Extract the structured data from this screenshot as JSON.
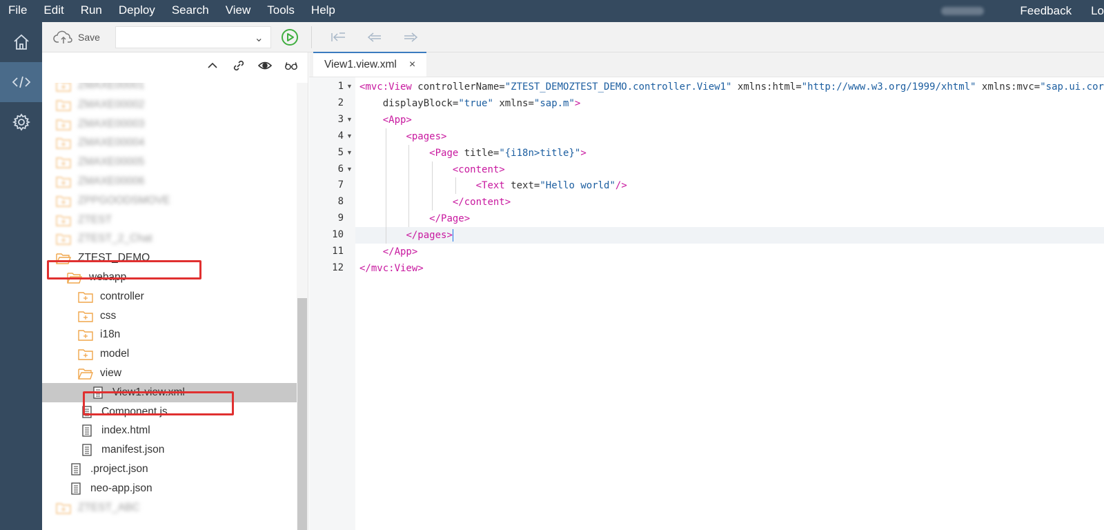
{
  "menubar": {
    "items": [
      "File",
      "Edit",
      "Run",
      "Deploy",
      "Search",
      "View",
      "Tools",
      "Help"
    ],
    "feedback": "Feedback",
    "logout": "Lo"
  },
  "toolbar": {
    "save_label": "Save",
    "combo_value": ""
  },
  "tree": {
    "items": [
      {
        "label": "ZMAXE00001",
        "kind": "folder-closed",
        "blurred": true
      },
      {
        "label": "ZMAXE00002",
        "kind": "folder-closed",
        "blurred": true
      },
      {
        "label": "ZMAXE00003",
        "kind": "folder-closed",
        "blurred": true
      },
      {
        "label": "ZMAXE00004",
        "kind": "folder-closed",
        "blurred": true
      },
      {
        "label": "ZMAXE00005",
        "kind": "folder-closed",
        "blurred": true
      },
      {
        "label": "ZMAXE00006",
        "kind": "folder-closed",
        "blurred": true
      },
      {
        "label": "ZPPGOODSMOVE",
        "kind": "folder-closed",
        "blurred": true
      },
      {
        "label": "ZTEST",
        "kind": "folder-closed",
        "blurred": true
      },
      {
        "label": "ZTEST_2_Chat",
        "kind": "folder-closed",
        "blurred": true
      },
      {
        "label": "ZTEST_DEMO",
        "kind": "folder-open",
        "blurred": false
      },
      {
        "label": "webapp",
        "kind": "folder-open",
        "blurred": false
      },
      {
        "label": "controller",
        "kind": "folder-closed",
        "blurred": false
      },
      {
        "label": "css",
        "kind": "folder-closed",
        "blurred": false
      },
      {
        "label": "i18n",
        "kind": "folder-closed",
        "blurred": false
      },
      {
        "label": "model",
        "kind": "folder-closed",
        "blurred": false
      },
      {
        "label": "view",
        "kind": "folder-open",
        "blurred": false
      },
      {
        "label": "View1.view.xml",
        "kind": "file",
        "blurred": false
      },
      {
        "label": "Component.js",
        "kind": "file",
        "blurred": false
      },
      {
        "label": "index.html",
        "kind": "file",
        "blurred": false
      },
      {
        "label": "manifest.json",
        "kind": "file",
        "blurred": false
      },
      {
        "label": ".project.json",
        "kind": "file",
        "blurred": false
      },
      {
        "label": "neo-app.json",
        "kind": "file",
        "blurred": false
      },
      {
        "label": "ZTEST_ABC",
        "kind": "folder-closed",
        "blurred": true
      }
    ],
    "selected_index": 16
  },
  "editor": {
    "tab_label": "View1.view.xml",
    "tab_close": "×",
    "active_line": 10,
    "lines": [
      [
        [
          "tag",
          "<mvc:View"
        ],
        [
          "attr",
          " controllerName"
        ],
        [
          "eq",
          "="
        ],
        [
          "val",
          "\"ZTEST_DEMOZTEST_DEMO.controller.View1\""
        ],
        [
          "attr",
          " xmlns:html"
        ],
        [
          "eq",
          "="
        ],
        [
          "val",
          "\"http://www.w3.org/1999/xhtml\""
        ],
        [
          "attr",
          " xmlns:mvc"
        ],
        [
          "eq",
          "="
        ],
        [
          "val",
          "\"sap.ui.core.mvc\""
        ]
      ],
      [
        [
          "attr",
          "displayBlock"
        ],
        [
          "eq",
          "="
        ],
        [
          "val",
          "\"true\""
        ],
        [
          "attr",
          " xmlns"
        ],
        [
          "eq",
          "="
        ],
        [
          "val",
          "\"sap.m\""
        ],
        [
          "tag",
          ">"
        ]
      ],
      [
        [
          "tag",
          "<App>"
        ]
      ],
      [
        [
          "tag",
          "<pages>"
        ]
      ],
      [
        [
          "tag",
          "<Page"
        ],
        [
          "attr",
          " title"
        ],
        [
          "eq",
          "="
        ],
        [
          "val",
          "\"{i18n>title}\""
        ],
        [
          "tag",
          ">"
        ]
      ],
      [
        [
          "tag",
          "<content>"
        ]
      ],
      [
        [
          "tag",
          "<Text"
        ],
        [
          "attr",
          " text"
        ],
        [
          "eq",
          "="
        ],
        [
          "val",
          "\"Hello world\""
        ],
        [
          "tag",
          "/>"
        ]
      ],
      [
        [
          "tag",
          "</content>"
        ]
      ],
      [
        [
          "tag",
          "</Page>"
        ]
      ],
      [
        [
          "tag",
          "</pages>"
        ]
      ],
      [
        [
          "tag",
          "</App>"
        ]
      ],
      [
        [
          "tag",
          "</mvc:View>"
        ]
      ]
    ],
    "fold_lines": [
      1,
      3,
      4,
      5,
      6
    ]
  },
  "colors": {
    "shell": "#354a5f",
    "rail_active": "#4a6b8a",
    "folder": "#f0a54a",
    "xml_tag": "#c8189f",
    "xml_value": "#1c5ea0",
    "highlight": "#e03030",
    "run": "#3fae3f"
  },
  "icons": {
    "rail": [
      "home-icon",
      "code-icon",
      "settings-icon"
    ],
    "toolbar": [
      "cloud-save-icon",
      "chevron-down-icon",
      "run-icon",
      "navigate-last-edit-icon",
      "back-arrow-icon",
      "forward-arrow-icon"
    ],
    "tree_tools": [
      "collapse-all-icon",
      "link-editor-icon",
      "show-hidden-icon",
      "preview-glasses-icon"
    ]
  }
}
